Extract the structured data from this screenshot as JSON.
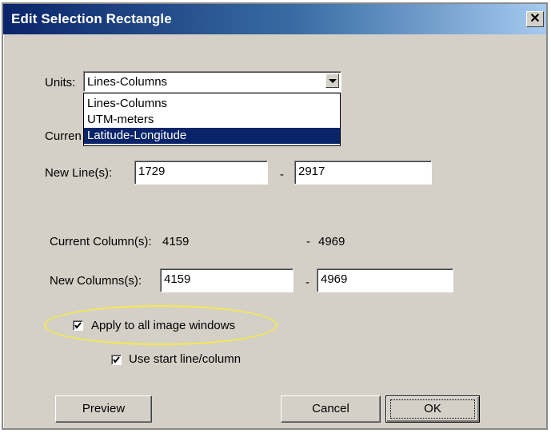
{
  "window": {
    "title": "Edit Selection Rectangle",
    "close_glyph": "✕"
  },
  "units": {
    "label": "Units:",
    "selected": "Lines-Columns",
    "options": [
      "Lines-Columns",
      "UTM-meters",
      "Latitude-Longitude"
    ],
    "highlighted_option": "Latitude-Longitude"
  },
  "current_lines": {
    "label_partial": "Curren"
  },
  "new_lines": {
    "label": "New Line(s):",
    "start": "1729",
    "separator": "-",
    "end": "2917"
  },
  "current_columns": {
    "label": "Current Column(s):",
    "start": "4159",
    "separator": "-",
    "end": "4969"
  },
  "new_columns": {
    "label": "New Columns(s):",
    "start": "4159",
    "separator": "-",
    "end": "4969"
  },
  "checkboxes": {
    "apply_all": {
      "label": "Apply to all image windows",
      "checked": true
    },
    "use_start": {
      "label": "Use start line/column",
      "checked": true
    }
  },
  "buttons": {
    "preview": "Preview",
    "cancel": "Cancel",
    "ok": "OK"
  },
  "colors": {
    "title_bar": "#0a246a",
    "selection": "#0a246a",
    "annotation_ellipse": "#f5e94a",
    "dialog_bg": "#d4d0c8"
  }
}
